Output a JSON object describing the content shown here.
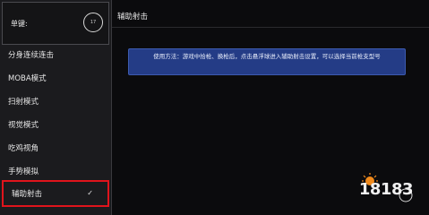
{
  "sidebar": {
    "key": {
      "label": "单键:",
      "circle_text": "17"
    },
    "items": [
      {
        "label": "分身连续连击",
        "active": false
      },
      {
        "label": "MOBA模式",
        "active": false
      },
      {
        "label": "扫射模式",
        "active": false
      },
      {
        "label": "视觉模式",
        "active": false
      },
      {
        "label": "吃鸡视角",
        "active": false
      },
      {
        "label": "手势模拟",
        "active": false
      },
      {
        "label": "辅助射击",
        "active": true,
        "check": "✓"
      }
    ]
  },
  "main": {
    "title": "辅助射击",
    "info": "使用方法：游戏中拾枪、换枪后，点击悬浮球进入辅助射击设置，可以选择当前枪支型号"
  },
  "watermark": {
    "text": "18183"
  },
  "colors": {
    "highlight_border": "#e0141c",
    "info_bg": "#243c86"
  }
}
